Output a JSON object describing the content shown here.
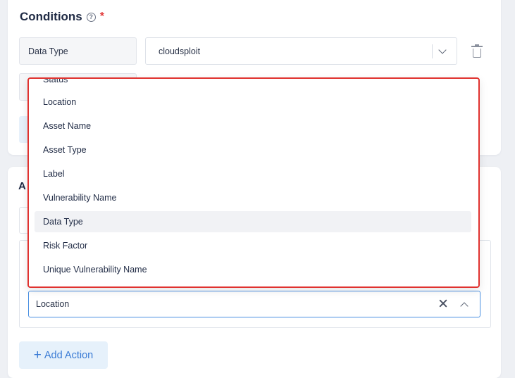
{
  "conditions": {
    "title": "Conditions",
    "help_icon": "?",
    "required_mark": "*",
    "row1_label": "Data Type",
    "row1_value": "cloudsploit"
  },
  "actions": {
    "title_partial": "A",
    "selected_value": "Location",
    "add_action_label": "Add Action",
    "add_action_plus": "+"
  },
  "dropdown": {
    "items": [
      {
        "label": "Status"
      },
      {
        "label": "Location"
      },
      {
        "label": "Asset Name"
      },
      {
        "label": "Asset Type"
      },
      {
        "label": "Label"
      },
      {
        "label": "Vulnerability Name"
      },
      {
        "label": "Data Type"
      },
      {
        "label": "Risk Factor"
      },
      {
        "label": "Unique Vulnerability Name"
      }
    ],
    "highlighted": "Data Type"
  },
  "colors": {
    "accent": "#3a7bd5",
    "highlight_border": "#e0322f",
    "focus_border": "#4a90e2"
  }
}
